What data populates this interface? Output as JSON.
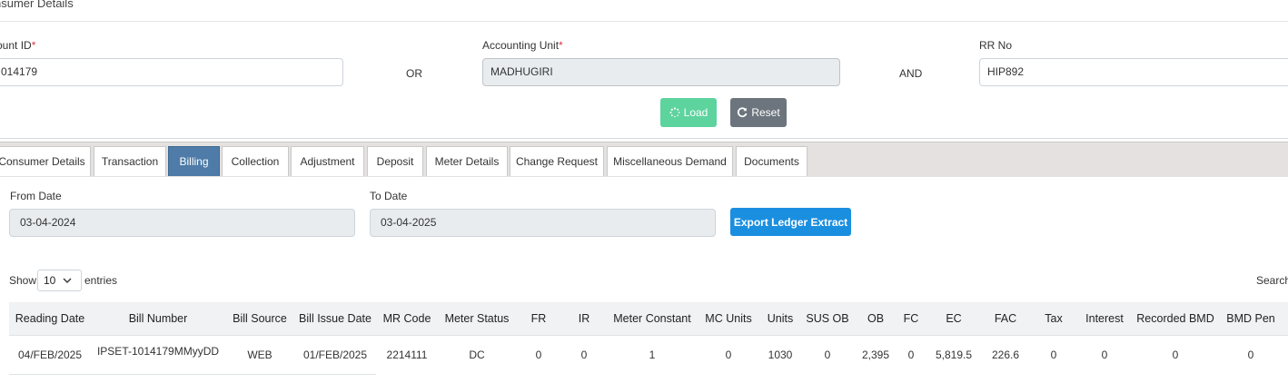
{
  "section_title": "nsumer Details",
  "top_form": {
    "account_id_label": "ount ID",
    "account_id_value": "014179",
    "or_text": "OR",
    "accounting_unit_label": "Accounting Unit",
    "accounting_unit_value": "MADHUGIRI",
    "and_text": "AND",
    "rr_no_label": "RR No",
    "rr_no_value": "HIP892",
    "required_mark": "*",
    "load_label": "Load",
    "reset_label": "Reset"
  },
  "tabs": [
    {
      "label": "Consumer Details"
    },
    {
      "label": "Transaction"
    },
    {
      "label": "Billing",
      "active": true
    },
    {
      "label": "Collection"
    },
    {
      "label": "Adjustment"
    },
    {
      "label": "Deposit"
    },
    {
      "label": "Meter Details"
    },
    {
      "label": "Change Request"
    },
    {
      "label": "Miscellaneous Demand"
    },
    {
      "label": "Documents"
    }
  ],
  "filters": {
    "from_date_label": "From Date",
    "from_date_value": "03-04-2024",
    "to_date_label": "To Date",
    "to_date_value": "03-04-2025",
    "export_label": "Export Ledger Extract"
  },
  "table_controls": {
    "show_label": "Show",
    "entries_value": "10",
    "entries_label": "entries",
    "search_label": "Search:"
  },
  "table": {
    "headers": [
      "Reading Date",
      "Bill Number",
      "Bill Source",
      "Bill Issue Date",
      "MR Code",
      "Meter Status",
      "FR",
      "IR",
      "Meter Constant",
      "MC Units",
      "Units",
      "SUS OB",
      "OB",
      "FC",
      "EC",
      "FAC",
      "Tax",
      "Interest",
      "Recorded BMD",
      "BMD Pen"
    ],
    "rows": [
      [
        "04/FEB/2025",
        "IPSET-1014179MMyyDD",
        "WEB",
        "01/FEB/2025",
        "2214111",
        "DC",
        "0",
        "0",
        "1",
        "0",
        "1030",
        "0",
        "2,395",
        "0",
        "5,819.5",
        "226.6",
        "0",
        "0",
        "0",
        "0"
      ]
    ]
  },
  "colors": {
    "active_tab": "#4e7ba7",
    "load_button": "#5dd39e",
    "reset_button": "#6c757d",
    "export_button": "#1a8fe0",
    "tab_bar": "#e4e1e0"
  }
}
